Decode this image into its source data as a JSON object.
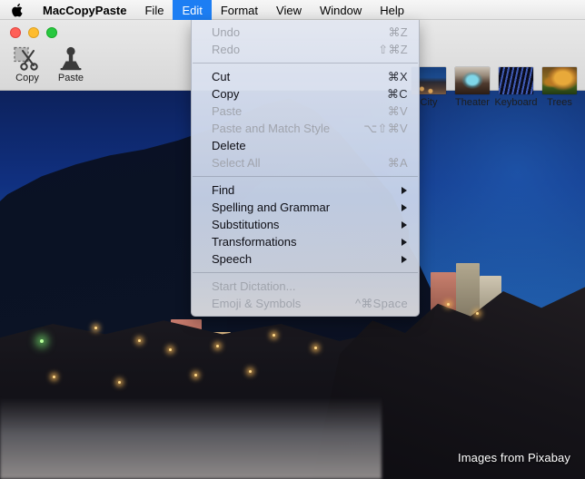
{
  "menubar": {
    "apple_icon": "apple-logo-icon",
    "items": [
      {
        "label": "MacCopyPaste",
        "bold": true,
        "active": false
      },
      {
        "label": "File",
        "bold": false,
        "active": false
      },
      {
        "label": "Edit",
        "bold": false,
        "active": true
      },
      {
        "label": "Format",
        "bold": false,
        "active": false
      },
      {
        "label": "View",
        "bold": false,
        "active": false
      },
      {
        "label": "Window",
        "bold": false,
        "active": false
      },
      {
        "label": "Help",
        "bold": false,
        "active": false
      }
    ],
    "highlight_color": "#1d7ef3"
  },
  "window": {
    "traffic_lights": {
      "close": "#ff5f57",
      "minimize": "#febc2e",
      "zoom": "#28c840"
    },
    "toolbar": {
      "buttons": [
        {
          "label": "Copy",
          "icon": "scissors-icon"
        },
        {
          "label": "Paste",
          "icon": "stamp-icon"
        }
      ],
      "thumbnails": [
        {
          "label": "City",
          "icon": "city-thumbnail"
        },
        {
          "label": "Theater",
          "icon": "theater-thumbnail"
        },
        {
          "label": "Keyboard",
          "icon": "keyboard-thumbnail"
        },
        {
          "label": "Trees",
          "icon": "trees-thumbnail"
        }
      ]
    }
  },
  "edit_menu": {
    "title": "Edit",
    "groups": [
      {
        "items": [
          {
            "label": "Undo",
            "shortcut": "⌘Z",
            "enabled": false,
            "submenu": false
          },
          {
            "label": "Redo",
            "shortcut": "⇧⌘Z",
            "enabled": false,
            "submenu": false
          }
        ]
      },
      {
        "items": [
          {
            "label": "Cut",
            "shortcut": "⌘X",
            "enabled": true,
            "submenu": false
          },
          {
            "label": "Copy",
            "shortcut": "⌘C",
            "enabled": true,
            "submenu": false
          },
          {
            "label": "Paste",
            "shortcut": "⌘V",
            "enabled": false,
            "submenu": false
          },
          {
            "label": "Paste and Match Style",
            "shortcut": "⌥⇧⌘V",
            "enabled": false,
            "submenu": false
          },
          {
            "label": "Delete",
            "shortcut": "",
            "enabled": true,
            "submenu": false
          },
          {
            "label": "Select All",
            "shortcut": "⌘A",
            "enabled": false,
            "submenu": false
          }
        ]
      },
      {
        "items": [
          {
            "label": "Find",
            "shortcut": "",
            "enabled": true,
            "submenu": true
          },
          {
            "label": "Spelling and Grammar",
            "shortcut": "",
            "enabled": true,
            "submenu": true
          },
          {
            "label": "Substitutions",
            "shortcut": "",
            "enabled": true,
            "submenu": true
          },
          {
            "label": "Transformations",
            "shortcut": "",
            "enabled": true,
            "submenu": true
          },
          {
            "label": "Speech",
            "shortcut": "",
            "enabled": true,
            "submenu": true
          }
        ]
      },
      {
        "items": [
          {
            "label": "Start Dictation...",
            "shortcut": "",
            "enabled": false,
            "submenu": false
          },
          {
            "label": "Emoji & Symbols",
            "shortcut": "^⌘Space",
            "enabled": false,
            "submenu": false
          }
        ]
      }
    ]
  },
  "desktop": {
    "credit": "Images from Pixabay"
  }
}
